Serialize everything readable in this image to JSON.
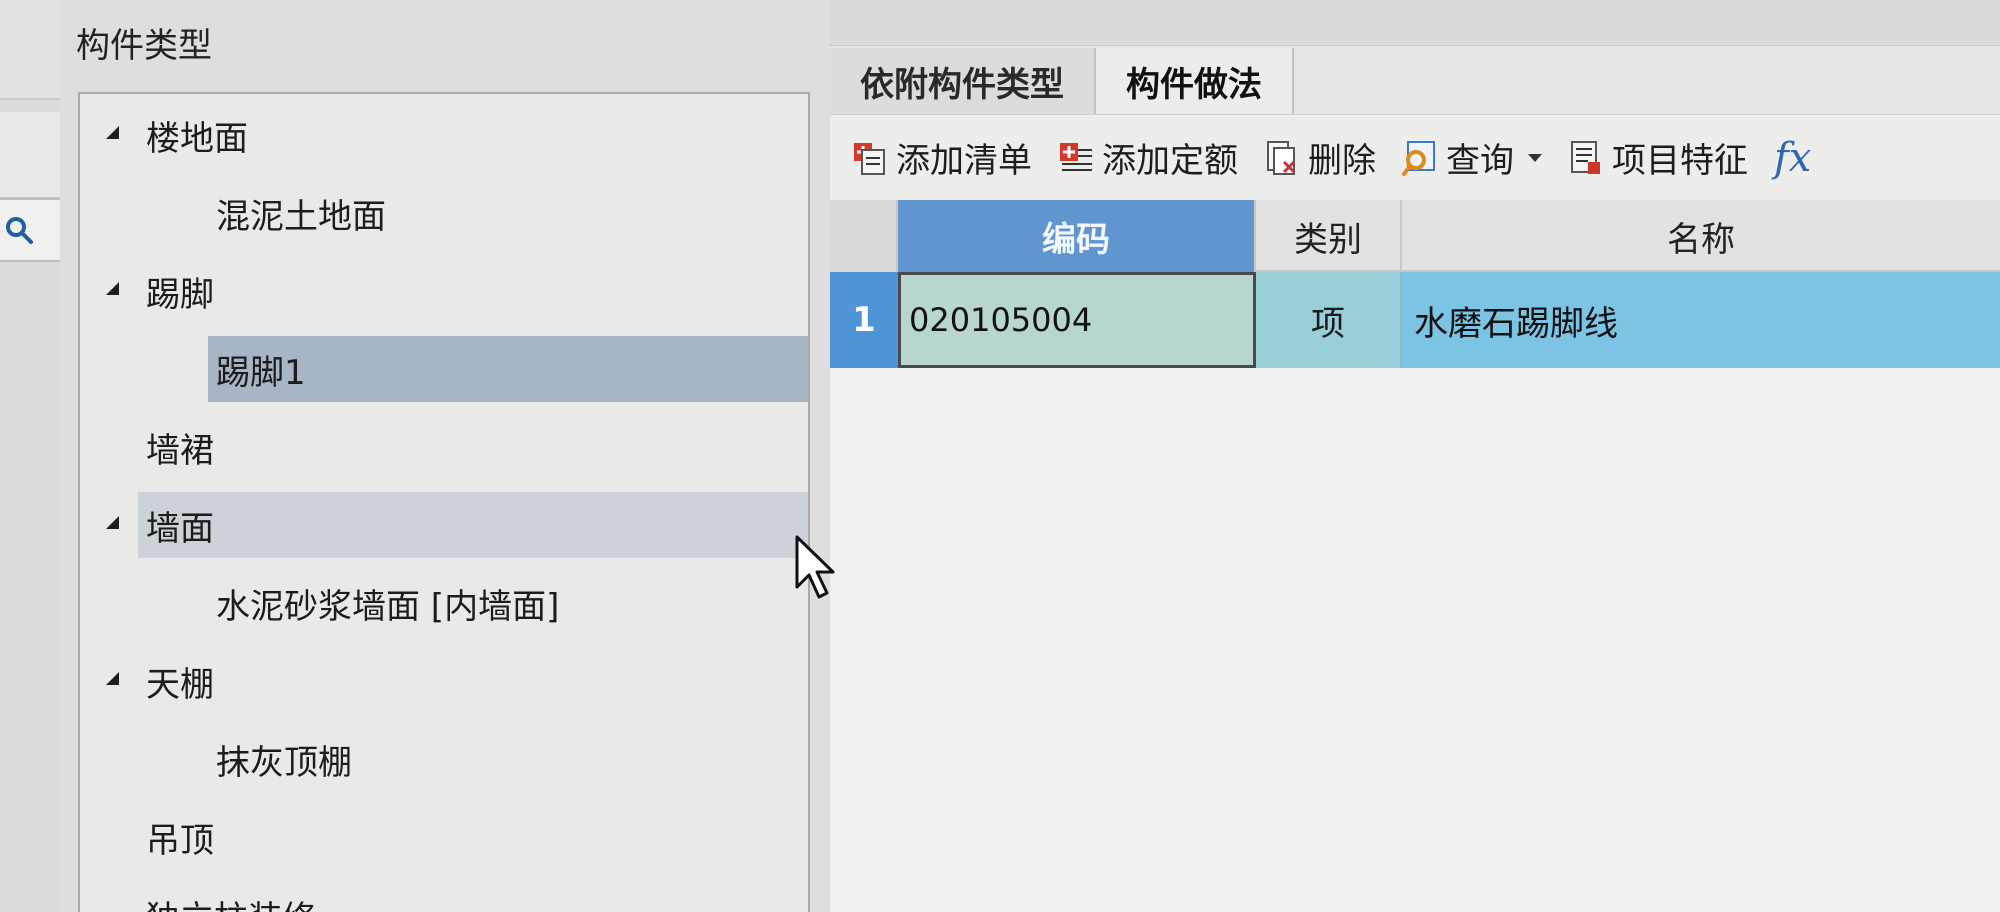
{
  "type_panel": {
    "title": "构件类型",
    "tree": [
      {
        "label": "楼地面",
        "level": 1,
        "expanded": true
      },
      {
        "label": "混泥土地面",
        "level": 2
      },
      {
        "label": "踢脚",
        "level": 1,
        "expanded": true
      },
      {
        "label": "踢脚1",
        "level": 2,
        "selected": true
      },
      {
        "label": "墙裙",
        "level": 1
      },
      {
        "label": "墙面",
        "level": 1,
        "expanded": true,
        "highlighted": true
      },
      {
        "label": "水泥砂浆墙面 [内墙面]",
        "level": 2
      },
      {
        "label": "天棚",
        "level": 1,
        "expanded": true
      },
      {
        "label": "抹灰顶棚",
        "level": 2
      },
      {
        "label": "吊顶",
        "level": 1
      },
      {
        "label": "独立柱装修",
        "level": 1
      }
    ]
  },
  "tabs": [
    {
      "label": "依附构件类型",
      "active": false
    },
    {
      "label": "构件做法",
      "active": true
    }
  ],
  "toolbar": {
    "add_list": "添加清单",
    "add_quota": "添加定额",
    "delete": "删除",
    "query": "查询",
    "item_feature": "项目特征",
    "fx": "fx"
  },
  "grid": {
    "headers": {
      "code": "编码",
      "type": "类别",
      "name": "名称"
    },
    "rows": [
      {
        "num": "1",
        "code": "020105004",
        "type": "项",
        "name": "水磨石踢脚线"
      }
    ]
  },
  "colors": {
    "header_selected": "#5f96cf",
    "row_selected": "#7cc4e3",
    "tree_selected": "#a7b5c6"
  }
}
